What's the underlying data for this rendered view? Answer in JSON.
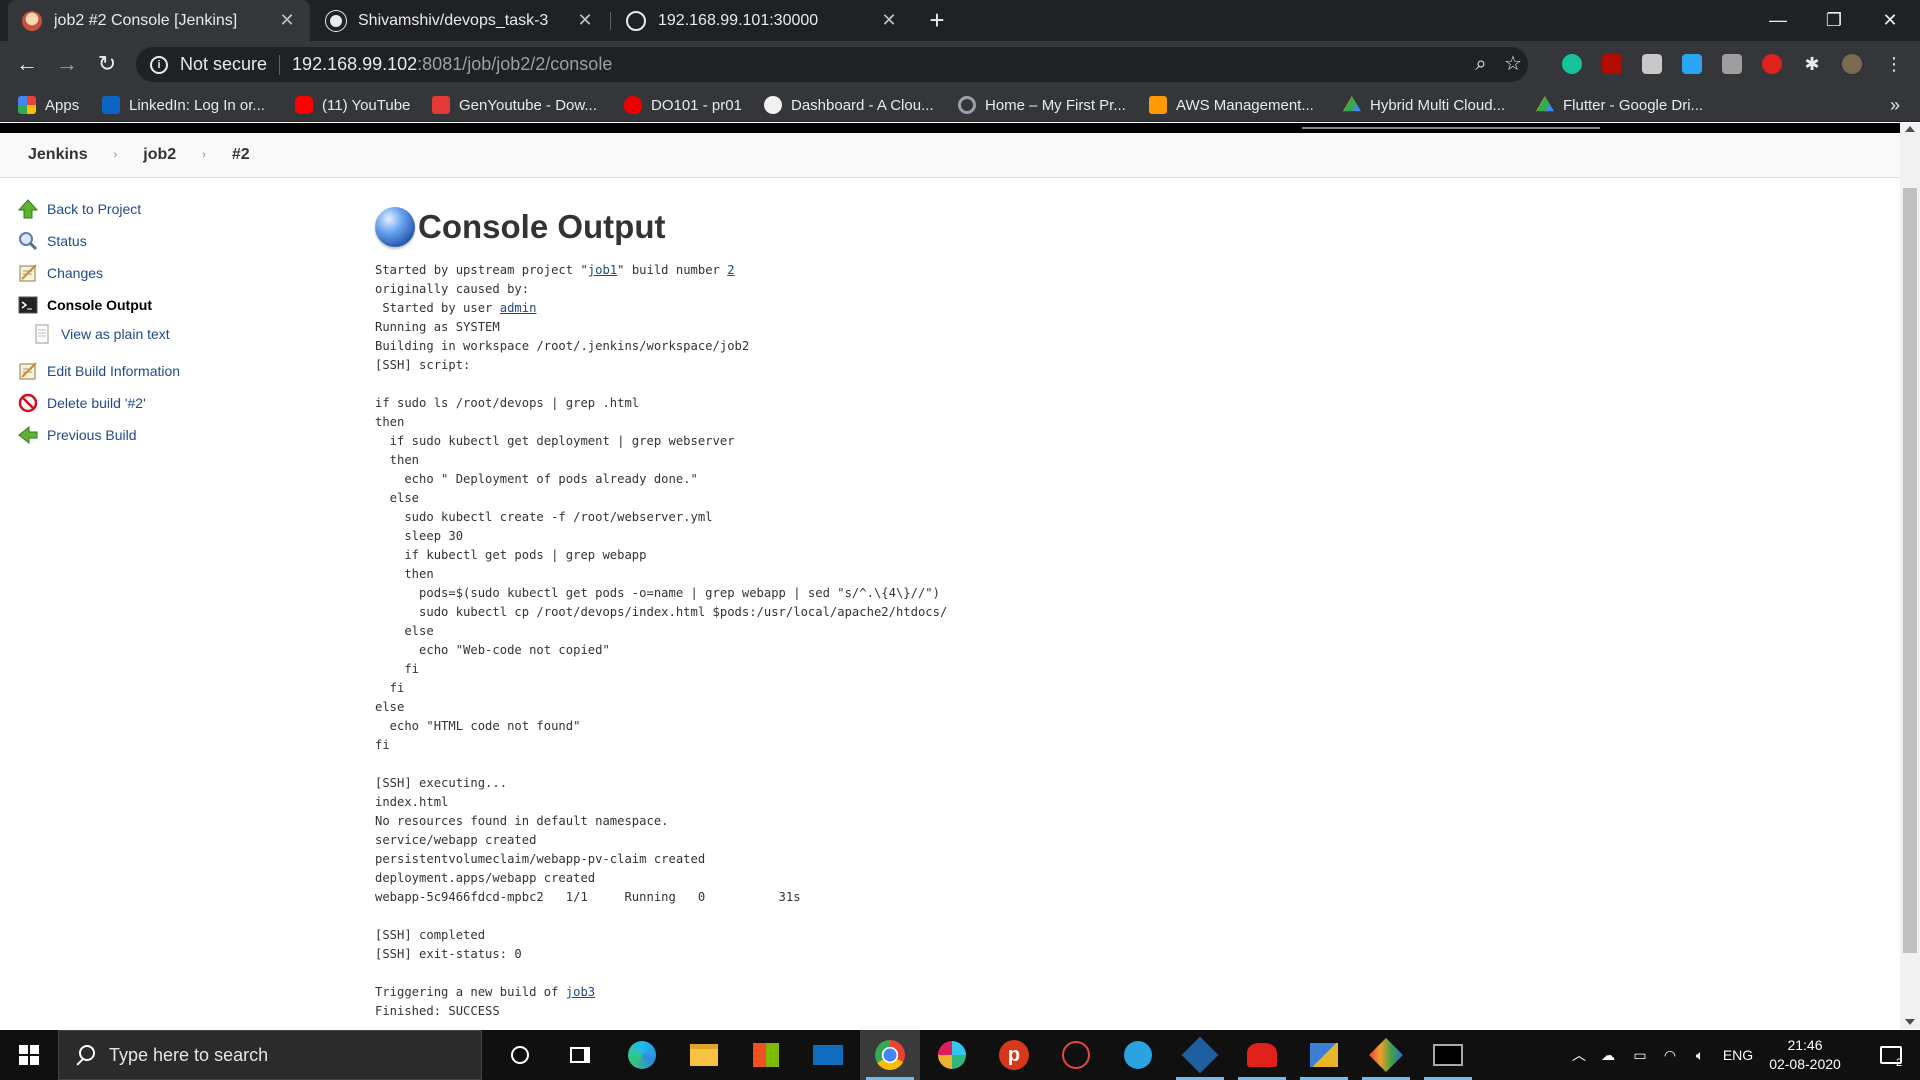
{
  "browser": {
    "tabs": [
      {
        "title": "job2 #2 Console [Jenkins]",
        "active": true
      },
      {
        "title": "Shivamshiv/devops_task-3",
        "active": false
      },
      {
        "title": "192.168.99.101:30000",
        "active": false
      }
    ],
    "address": {
      "security": "Not secure",
      "host": "192.168.99.102",
      "path": ":8081/job/job2/2/console"
    },
    "bookmarks": [
      {
        "label": "Apps",
        "icon": "apps-grid-icon",
        "color": "#ea4335"
      },
      {
        "label": "LinkedIn: Log In or...",
        "icon": "linkedin-icon",
        "color": "#0a66c2"
      },
      {
        "label": "(11) YouTube",
        "icon": "youtube-icon",
        "color": "#ff0000"
      },
      {
        "label": "GenYoutube - Dow...",
        "icon": "genyoutube-icon",
        "color": "#e53935"
      },
      {
        "label": "DO101 - pr01",
        "icon": "redhat-icon",
        "color": "#ee0000"
      },
      {
        "label": "Dashboard - A Clou...",
        "icon": "cloud-icon",
        "color": "#f1f1f1"
      },
      {
        "label": "Home – My First Pr...",
        "icon": "gear-icon",
        "color": "#9aa0a6"
      },
      {
        "label": "AWS Management...",
        "icon": "aws-icon",
        "color": "#ff9900"
      },
      {
        "label": "Hybrid Multi Cloud...",
        "icon": "google-drive-icon",
        "color": "#34a853"
      },
      {
        "label": "Flutter - Google Dri...",
        "icon": "google-drive-icon",
        "color": "#fbbc04"
      }
    ]
  },
  "jenkins": {
    "breadcrumb": [
      "Jenkins",
      "job2",
      "#2"
    ],
    "side_tasks": [
      {
        "label": "Back to Project",
        "icon": "up-arrow-icon"
      },
      {
        "label": "Status",
        "icon": "magnifier-icon"
      },
      {
        "label": "Changes",
        "icon": "notepad-icon"
      },
      {
        "label": "Console Output",
        "icon": "terminal-icon"
      },
      {
        "label": "View as plain text",
        "icon": "document-icon"
      },
      {
        "label": "Edit Build Information",
        "icon": "notepad-icon"
      },
      {
        "label": "Delete build '#2'",
        "icon": "no-entry-icon"
      },
      {
        "label": "Previous Build",
        "icon": "left-arrow-icon"
      }
    ],
    "heading": "Console Output",
    "console": {
      "l1_pre": "Started by upstream project \"",
      "l1_link": "job1",
      "l1_mid": "\" build number ",
      "l1_num": "2",
      "l2": "originally caused by:",
      "l3_pre": " Started by user ",
      "l3_link": "admin",
      "body": "Running as SYSTEM\nBuilding in workspace /root/.jenkins/workspace/job2\n[SSH] script:\n\nif sudo ls /root/devops | grep .html\nthen\n  if sudo kubectl get deployment | grep webserver\n  then\n    echo \" Deployment of pods already done.\"\n  else\n    sudo kubectl create -f /root/webserver.yml\n    sleep 30\n    if kubectl get pods | grep webapp\n    then\n      pods=$(sudo kubectl get pods -o=name | grep webapp | sed \"s/^.\\{4\\}//\")\n      sudo kubectl cp /root/devops/index.html $pods:/usr/local/apache2/htdocs/\n    else\n      echo \"Web-code not copied\"\n    fi\n  fi\nelse\n  echo \"HTML code not found\"\nfi\n\n[SSH] executing...\nindex.html\nNo resources found in default namespace.\nservice/webapp created\npersistentvolumeclaim/webapp-pv-claim created\ndeployment.apps/webapp created\nwebapp-5c9466fdcd-mpbc2   1/1     Running   0          31s\n\n[SSH] completed\n[SSH] exit-status: 0\n\n",
      "trigger_pre": "Triggering a new build of ",
      "trigger_link": "job3",
      "finished": "Finished: SUCCESS"
    }
  },
  "taskbar": {
    "search_placeholder": "Type here to search",
    "language": "ENG",
    "time": "21:46",
    "date": "02-08-2020",
    "notification_count": "2"
  }
}
